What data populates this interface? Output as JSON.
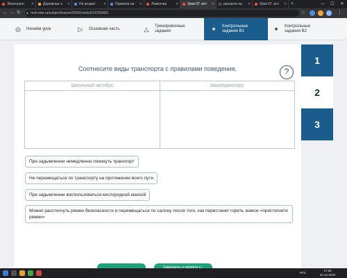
{
  "browser": {
    "tabs": [
      {
        "label": "Электронн",
        "active": false
      },
      {
        "label": "Дорожные к",
        "active": false
      },
      {
        "label": "Не входит",
        "active": false
      },
      {
        "label": "Правила на",
        "active": false
      },
      {
        "label": "Левенчик",
        "active": false
      },
      {
        "label": "Урок 07. ист",
        "active": true
      },
      {
        "label": "решаете на",
        "active": false
      },
      {
        "label": "Урок 07. ист",
        "active": false
      }
    ],
    "new_tab": "+",
    "url": "resh.edu.ru/subject/lesson/3336/control/1/#193451"
  },
  "lesson_nav": {
    "steps": [
      {
        "label": "Начнём урок"
      },
      {
        "label": "Основная часть"
      },
      {
        "label": "Тренировочные задания"
      },
      {
        "label": "Контрольные задания В1"
      },
      {
        "label": "Контрольные задания В2"
      }
    ]
  },
  "task": {
    "title": "Соотнесите виды транспорта с правилами поведения.",
    "help": "?",
    "columns": [
      "Школьный автобус",
      "Авиатранспорт"
    ],
    "options": [
      "При задымлении немедленно покинуть транспорт",
      "Не перемещаться по транспорту на протяжении всего пути",
      "При задымлении воспользоваться кислородной маской",
      "Можно расстегнуть ремни безопасности и перемещаться по салону после того, как перестанет гореть значок «пристегните ремни»"
    ],
    "bottom_button": "Завершить и перейти к..."
  },
  "questions": [
    "1",
    "2",
    "3"
  ],
  "taskbar": {
    "time": "17:09",
    "date": "23.12.2020",
    "lang": "РУС"
  },
  "colors": {
    "primary": "#1a5c8c",
    "accent_green": "#1fa37a",
    "chip_border": "#a6c0d6"
  }
}
